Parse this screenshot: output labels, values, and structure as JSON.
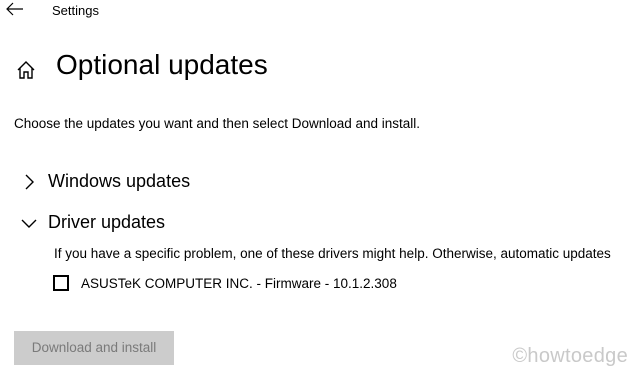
{
  "header": {
    "back_icon": "back-arrow-icon",
    "window_title": "Settings"
  },
  "page": {
    "home_icon": "home-icon",
    "title": "Optional updates",
    "description": "Choose the updates you want and then select Download and install."
  },
  "sections": [
    {
      "label": "Windows updates",
      "expanded": false,
      "icon": "chevron-right-icon"
    },
    {
      "label": "Driver updates",
      "expanded": true,
      "icon": "chevron-down-icon",
      "description": "If you have a specific problem, one of these drivers might help. Otherwise, automatic updates",
      "items": [
        {
          "label": "ASUSTeK COMPUTER INC. - Firmware - 10.1.2.308",
          "checked": false
        }
      ]
    }
  ],
  "actions": {
    "download_label": "Download and install",
    "download_enabled": false
  },
  "watermark": "©howtoedge",
  "colors": {
    "background": "#ffffff",
    "text": "#000000",
    "button_disabled_bg": "#cccccc",
    "button_disabled_text": "#7a7a7a",
    "watermark": "#c9c9c9"
  }
}
